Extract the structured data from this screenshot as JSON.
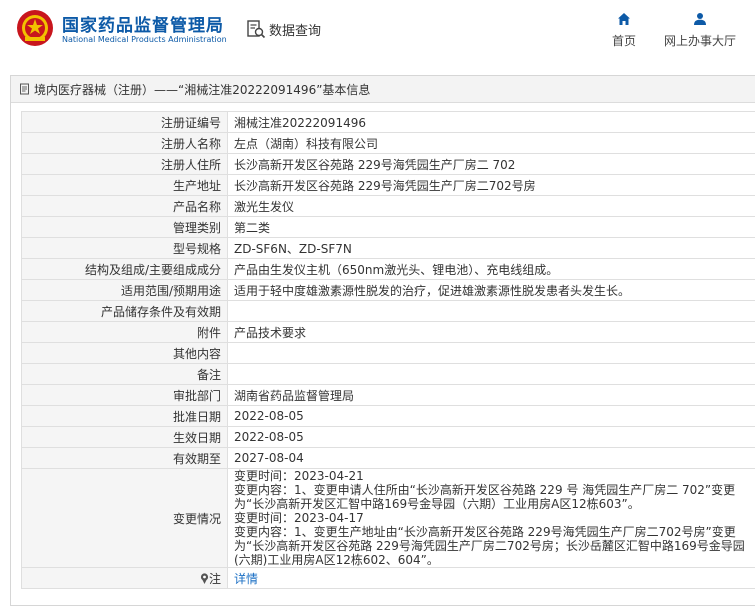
{
  "header": {
    "brand_cn": "国家药品监督管理局",
    "brand_en": "National Medical Products Administration",
    "search_label": "数据查询",
    "nav": {
      "home": "首页",
      "hall": "网上办事大厅"
    },
    "colors": {
      "brand": "#0d5aa7",
      "logo_red": "#c8161d",
      "logo_gold": "#f2c200"
    }
  },
  "page": {
    "title": "境内医疗器械（注册）——“湘械注准20222091496”基本信息"
  },
  "fields": [
    {
      "label": "注册证编号",
      "value": "湘械注准20222091496"
    },
    {
      "label": "注册人名称",
      "value": "左点（湖南）科技有限公司"
    },
    {
      "label": "注册人住所",
      "value": "长沙高新开发区谷苑路 229号海凭园生产厂房二 702"
    },
    {
      "label": "生产地址",
      "value": "长沙高新开发区谷苑路 229号海凭园生产厂房二702号房"
    },
    {
      "label": "产品名称",
      "value": "激光生发仪"
    },
    {
      "label": "管理类别",
      "value": "第二类"
    },
    {
      "label": "型号规格",
      "value": "ZD-SF6N、ZD-SF7N"
    },
    {
      "label": "结构及组成/主要组成成分",
      "value": "产品由生发仪主机（650nm激光头、锂电池）、充电线组成。"
    },
    {
      "label": "适用范围/预期用途",
      "value": "适用于轻中度雄激素源性脱发的治疗，促进雄激素源性脱发患者头发生长。"
    },
    {
      "label": "产品储存条件及有效期",
      "value": ""
    },
    {
      "label": "附件",
      "value": "产品技术要求"
    },
    {
      "label": "其他内容",
      "value": ""
    },
    {
      "label": "备注",
      "value": ""
    },
    {
      "label": "审批部门",
      "value": "湖南省药品监督管理局"
    },
    {
      "label": "批准日期",
      "value": "2022-08-05"
    },
    {
      "label": "生效日期",
      "value": "2022-08-05"
    },
    {
      "label": "有效期至",
      "value": "2027-08-04"
    }
  ],
  "change_info": {
    "label": "变更情况",
    "lines": [
      "变更时间：2023-04-21",
      "变更内容：1、变更申请人住所由“长沙高新开发区谷苑路 229 号 海凭园生产厂房二 702”变更",
      "为“长沙高新开发区汇智中路169号金导园（六期）工业用房A区12栋603”。",
      "变更时间：2023-04-17",
      "变更内容：1、变更生产地址由“长沙高新开发区谷苑路 229号海凭园生产厂房二702号房”变更",
      "为“长沙高新开发区谷苑路 229号海凭园生产厂房二702号房；长沙岳麓区汇智中路169号金导园",
      "(六期)工业用房A区12栋602、604”。"
    ]
  },
  "note_row": {
    "label": "注",
    "pin_icon": "pin-icon",
    "link": "详情"
  }
}
